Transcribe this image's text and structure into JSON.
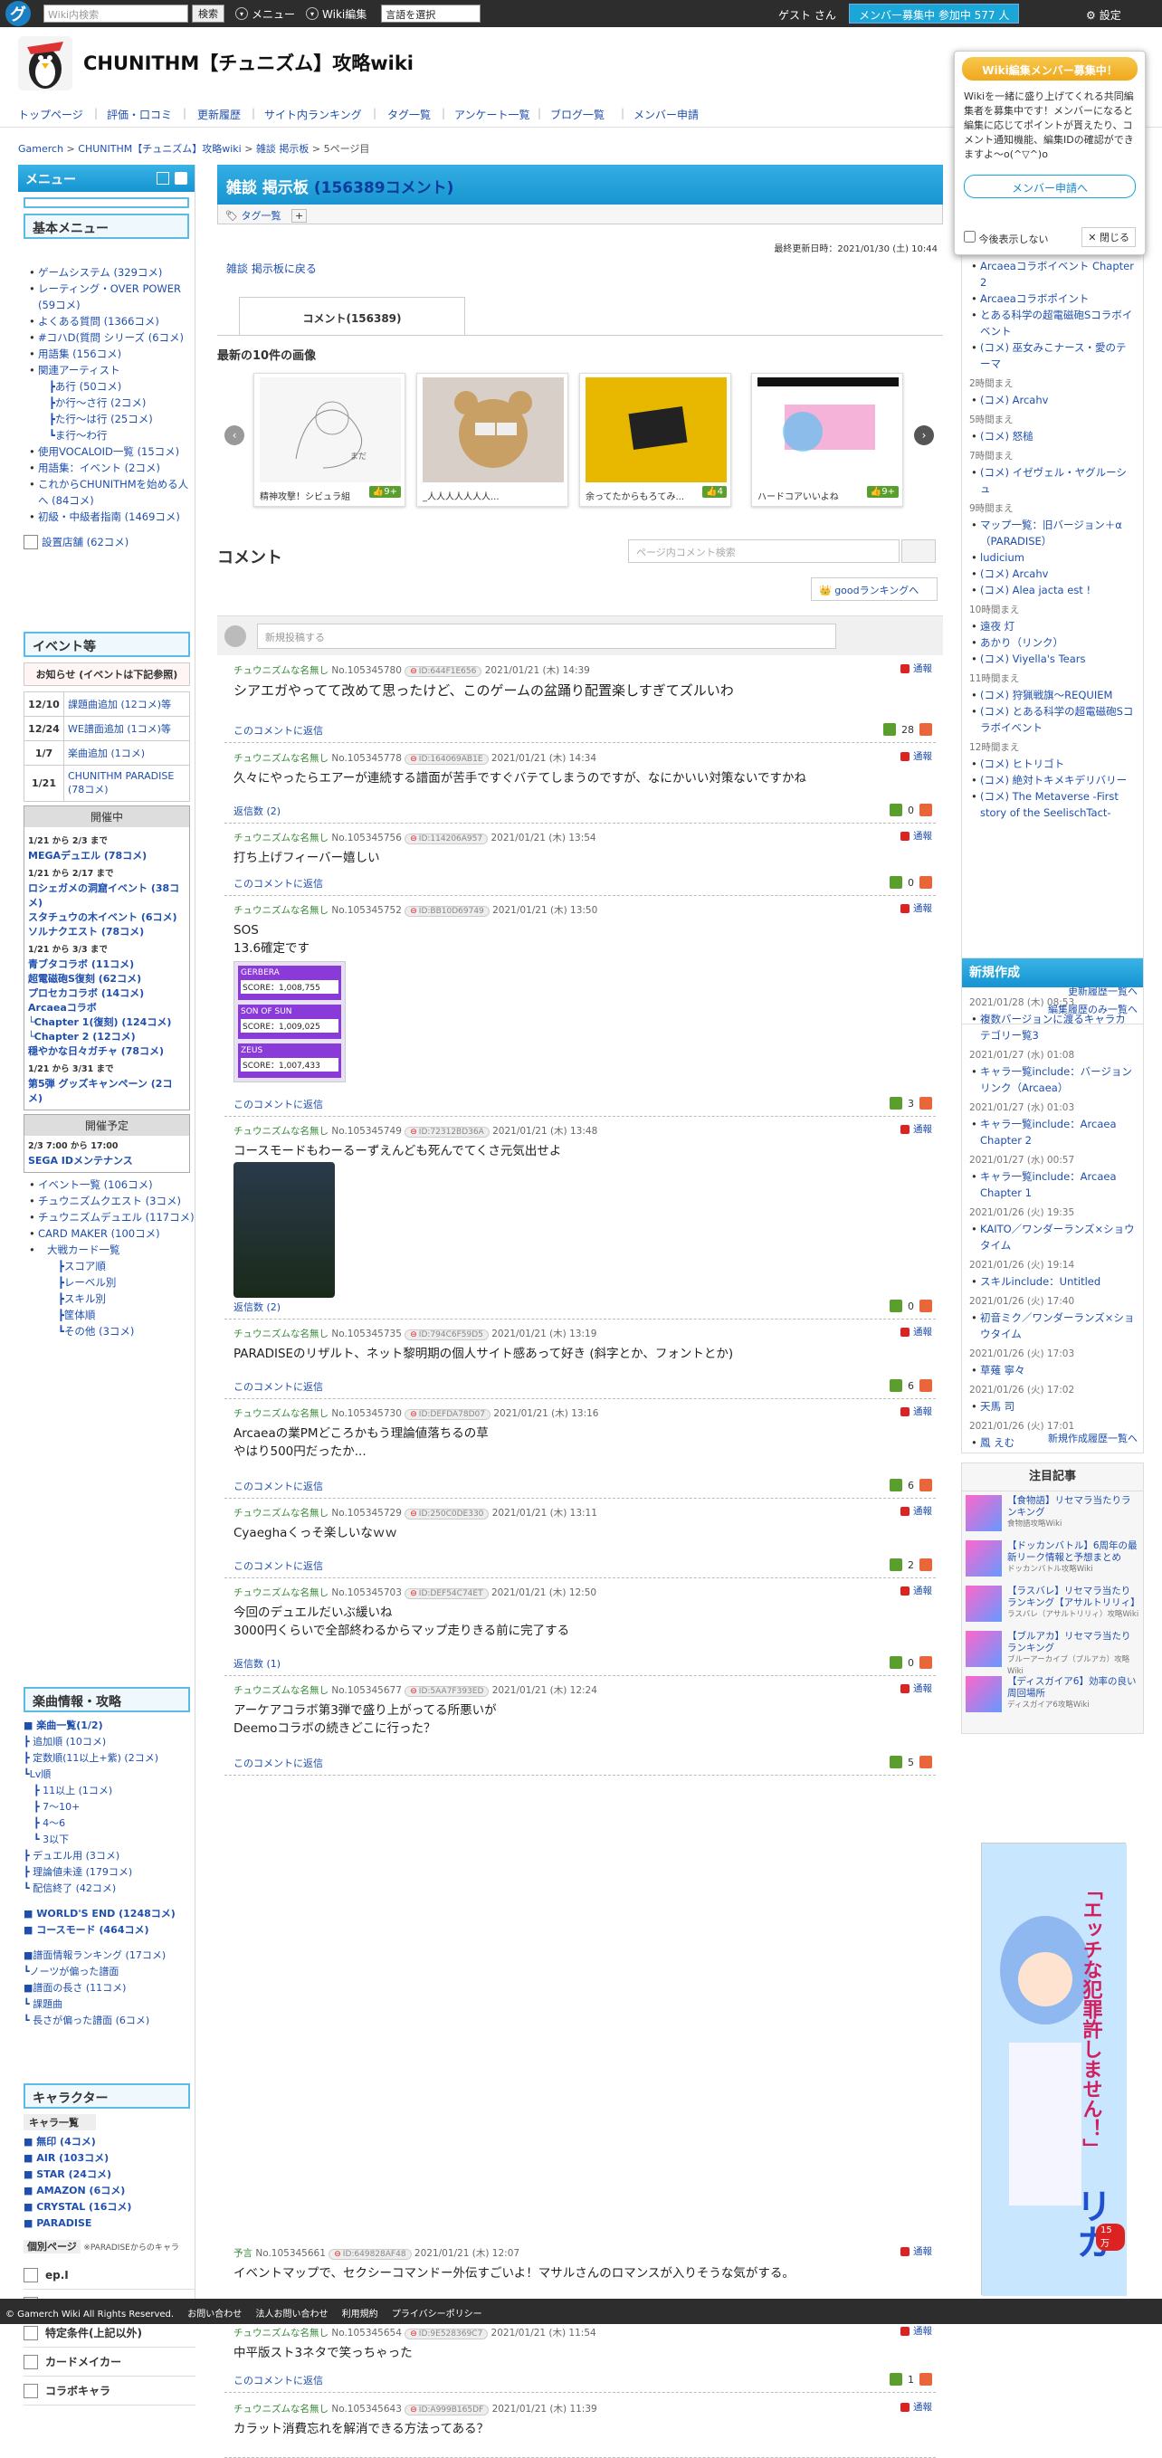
{
  "topbar": {
    "logo": "グ",
    "search_placeholder": "Wiki内検索",
    "search_btn": "検索",
    "menu": "メニュー",
    "wiki_edit": "Wiki編集",
    "lang": "言語を選択",
    "guest": "ゲスト さん",
    "member_btn": "メンバー募集中 参加中 577 人",
    "settings": "設定"
  },
  "header": {
    "title": "CHUNITHM【チュニズム】攻略wiki"
  },
  "nav": [
    "トップページ",
    "評価・口コミ",
    "更新履歴",
    "サイト内ランキング",
    "タグ一覧",
    "アンケート一覧",
    "ブログ一覧",
    "メンバー申請"
  ],
  "breadcrumb": [
    "Gamerch",
    "CHUNITHM【チュニズム】攻略wiki",
    "雑談 掲示板",
    "5ページ目"
  ],
  "left": {
    "menu_title": "メニュー",
    "basic": "基本メニュー",
    "basic_items": [
      "ゲームシステム (329コメ)",
      "レーティング・OVER POWER (59コメ)",
      "よくある質問 (1366コメ)",
      "#コハD(質問 シリーズ (6コメ)",
      "用語集 (156コメ)",
      "関連アーティスト",
      "┣あ行 (50コメ)",
      "┣か行～さ行 (2コメ)",
      "┣た行～は行 (25コメ)",
      "┗ま行～わ行",
      "使用VOCALOID一覧 (15コメ)",
      "用語集：イベント (2コメ)",
      "これからCHUNITHMを始める人へ (84コメ)",
      "初級・中級者指南 (1469コメ)"
    ],
    "store": "設置店舗 (62コメ)",
    "event_title": "イベント等",
    "notice_title": "お知らせ (イベントは下記参照)",
    "notices": [
      {
        "date": "12/10",
        "text": "課題曲追加 (12コメ)等"
      },
      {
        "date": "12/24",
        "text": "WE譜面追加 (1コメ)等"
      },
      {
        "date": "1/7",
        "text": "楽曲追加 (1コメ)"
      },
      {
        "date": "1/21",
        "text": "CHUNITHM PARADISE (78コメ)"
      }
    ],
    "ongoing": "開催中",
    "ongoing_items": [
      "1/21 から 2/3 まで",
      "MEGAデュエル (78コメ)",
      "1/21 から 2/17 まで",
      "ロシェガメの洞窟イベント (38コメ)",
      "スタチュウの木イベント (6コメ)",
      "ソルナクエスト (78コメ)",
      "1/21 から 3/3 まで",
      "青ブタコラボ (11コメ)",
      "超電磁砲S復刻 (62コメ)",
      "プロセカコラボ (14コメ)",
      "Arcaeaコラボ",
      "└Chapter 1(復刻) (124コメ)",
      "└Chapter 2 (12コメ)",
      "穏やかな日々ガチャ (78コメ)",
      "1/21 から 3/31 まで",
      "第5弾 グッズキャンペーン (2コメ)"
    ],
    "planned": "開催予定",
    "planned_items": [
      "2/3 7:00 から 17:00",
      "SEGA IDメンテナンス"
    ],
    "event_links": [
      "イベント一覧 (106コメ)",
      "チュウニズムクエスト (3コメ)",
      "チュウニズムデュエル (117コメ)",
      "CARD MAKER (100コメ)",
      "大戦カード一覧",
      "┣スコア順",
      "┣レーベル別",
      "┣スキル別",
      "┣筐体順",
      "┗その他 (3コメ)"
    ],
    "music_title": "楽曲情報・攻略",
    "music_items": [
      "■ 楽曲一覧(1/2)",
      "┣ 追加順 (10コメ)",
      "┣ 定数順(11以上+紫) (2コメ)",
      "┗Lv順",
      "　┣ 11以上 (1コメ)",
      "　┣ 7～10+",
      "　┣ 4～6",
      "　┗ 3以下",
      "┣ デュエル用 (3コメ)",
      "┣ 理論値未達 (179コメ)",
      "┗ 配信終了 (42コメ)",
      "",
      "■ WORLD'S END (1248コメ)",
      "■ コースモード (464コメ)",
      "",
      "■譜面情報ランキング (17コメ)",
      "┗ノーツが偏った譜面",
      "■譜面の長さ (11コメ)",
      "┗ 課題曲",
      "┗ 長さが偏った譜面 (6コメ)"
    ],
    "chara_title": "キャラクター",
    "chara_sub": "キャラ一覧",
    "chara_items": [
      "■ 無印 (4コメ)",
      "■ AIR (103コメ)",
      "■ STAR (24コメ)",
      "■ AMAZON (6コメ)",
      "■ CRYSTAL (16コメ)",
      "■ PARADISE"
    ],
    "indiv": "個別ページ",
    "indiv_note": "※PARADISEからのキャラ",
    "indiv_items": [
      "ep.I",
      "イロドリミドリ",
      "特定条件(上記以外)",
      "カードメイカー",
      "コラボキャラ"
    ]
  },
  "main": {
    "title": "雑談 掲示板",
    "count": "(156389コメント)",
    "tag": "タグ一覧",
    "updated": "最終更新日時：2021/01/30 (土) 10:44",
    "back": "雑談 掲示板に戻る",
    "tab": "コメント(156389)",
    "images_title": "最新の10件の画像",
    "images": [
      {
        "cap": "精神攻撃！シビュラ組",
        "likes": "9+"
      },
      {
        "cap": "_人人人人人人人...",
        "likes": ""
      },
      {
        "cap": "余ってたからもろてみ...",
        "likes": "4"
      },
      {
        "cap": "ハードコアいいよね",
        "likes": "9+"
      }
    ],
    "comments_title": "コメント",
    "search_placeholder": "ページ内コメント検索",
    "good_rank": "goodランキングへ",
    "new_post": "新規投稿する",
    "report": "通報",
    "comments": [
      {
        "name": "チュウニズムな名無し",
        "no": "No.105345780",
        "id": "ID:644F1E656",
        "date": "2021/01/21 (木) 14:39",
        "body": "シアエガやってて改めて思ったけど、このゲームの盆踊り配置楽しすぎてズルいわ",
        "reply": "このコメントに返信",
        "up": "28",
        "big": true
      },
      {
        "name": "チュウニズムな名無し",
        "no": "No.105345778",
        "id": "ID:164069AB1E",
        "date": "2021/01/21 (木) 14:34",
        "body": "久々にやったらエアーが連続する譜面が苦手ですぐバテてしまうのですが、なにかいい対策ないですかね",
        "reply": "返信数 (2)",
        "up": "0"
      },
      {
        "name": "チュウニズムな名無し",
        "no": "No.105345756",
        "id": "ID:114206A957",
        "date": "2021/01/21 (木) 13:54",
        "body": "打ち上げフィーバー嬉しい",
        "reply": "このコメントに返信",
        "up": "0"
      },
      {
        "name": "チュウニズムな名無し",
        "no": "No.105345752",
        "id": "ID:BB10D69749",
        "date": "2021/01/21 (木) 13:50",
        "body": "SOS\n13.6確定です",
        "reply": "このコメントに返信",
        "up": "3"
      },
      {
        "name": "チュウニズムな名無し",
        "no": "No.105345749",
        "id": "ID:72312BD36A",
        "date": "2021/01/21 (木) 13:48",
        "body": "コースモードもわーるーずえんども死んでてくさ元気出せよ",
        "reply": "返信数 (2)",
        "up": "0"
      },
      {
        "name": "チュウニズムな名無し",
        "no": "No.105345735",
        "id": "ID:794C6F59D5",
        "date": "2021/01/21 (木) 13:19",
        "body": "PARADISEのリザルト、ネット黎明期の個人サイト感あって好き (斜字とか、フォントとか)",
        "reply": "このコメントに返信",
        "up": "6"
      },
      {
        "name": "チュウニズムな名無し",
        "no": "No.105345730",
        "id": "ID:DEFDA78D07",
        "date": "2021/01/21 (木) 13:16",
        "body": "Arcaeaの業PMどころかもう理論値落ちるの草\nやはり500円だったか...",
        "reply": "このコメントに返信",
        "up": "6"
      },
      {
        "name": "チュウニズムな名無し",
        "no": "No.105345729",
        "id": "ID:250C0DE330",
        "date": "2021/01/21 (木) 13:11",
        "body": "Cyaeghaくっそ楽しいなｗｗ",
        "reply": "このコメントに返信",
        "up": "2"
      },
      {
        "name": "チュウニズムな名無し",
        "no": "No.105345703",
        "id": "ID:DEF54C74ET",
        "date": "2021/01/21 (木) 12:50",
        "body": "今回のデュエルだいぶ緩いね\n3000円くらいで全部終わるからマップ走りきる前に完了する",
        "reply": "返信数 (1)",
        "up": "0"
      },
      {
        "name": "チュウニズムな名無し",
        "no": "No.105345677",
        "id": "ID:5AA7F393ED",
        "date": "2021/01/21 (木) 12:24",
        "body": "アーケアコラボ第3弾で盛り上がってる所悪いが\nDeemoコラボの続きどこに行った？",
        "reply": "このコメントに返信",
        "up": "5"
      },
      {
        "name": "予言",
        "no": "No.105345661",
        "id": "ID:649828AF48",
        "date": "2021/01/21 (木) 12:07",
        "body": "イベントマップで、セクシーコマンドー外伝すごいよ！マサルさんのロマンスが入りそうな気がする。",
        "reply": "このコメントに返信",
        "up": "0"
      },
      {
        "name": "チュウニズムな名無し",
        "no": "No.105345654",
        "id": "ID:9E528369C7",
        "date": "2021/01/21 (木) 11:54",
        "body": "中平版スト3ネタで笑っちゃった",
        "reply": "このコメントに返信",
        "up": "1"
      },
      {
        "name": "チュウニズムな名無し",
        "no": "No.105345643",
        "id": "ID:A999B165DF",
        "date": "2021/01/21 (木) 11:39",
        "body": "カラット消費忘れを解消できる方法ってある？",
        "reply": "",
        "up": ""
      }
    ],
    "scores": [
      {
        "song": "GERBERA",
        "score": "SCORE：1,008,755"
      },
      {
        "song": "SON OF SUN",
        "score": "SCORE：1,009,025"
      },
      {
        "song": "ZEUS",
        "score": "SCORE：1,007,433"
      }
    ]
  },
  "popup": {
    "title": "Wiki編集メンバー募集中！",
    "body": "Wikiを一緒に盛り上げてくれる共同編集者を募集中です！メンバーになると編集に応じてポイントが貰えたり、コメント通知機能、編集IDの確認ができますよ～o(^▽^)o",
    "btn": "メンバー申請へ",
    "noshow": "今後表示しない",
    "close": "閉じる"
  },
  "right": {
    "recent": [
      "Arcaeaコラボイベント Chapter 2",
      "Arcaeaコラボポイント",
      "とある科学の超電磁砲Sコラボイベント",
      "(コメ) 巫女みこナース・愛のテーマ",
      "2時間まえ",
      "(コメ) Arcahv",
      "5時間まえ",
      "(コメ) 怒槌",
      "7時間まえ",
      "(コメ) イゼヴェル・ヤグルーシュ",
      "9時間まえ",
      "マップ一覧：旧バージョン＋α（PARADISE）",
      "ludicium",
      "(コメ) Arcahv",
      "(コメ) Alea jacta est !",
      "10時間まえ",
      "遠夜 灯",
      "あかり（リンク）",
      "(コメ) Viyella's Tears",
      "11時間まえ",
      "(コメ) 狩猟戦旗～REQUIEM",
      "(コメ) とある科学の超電磁砲Sコラボイベント",
      "12時間まえ",
      "(コメ) ヒトリゴト",
      "(コメ) 絶対トキメキデリバリー",
      "(コメ) The Metaverse -First story of the SeelischTact-"
    ],
    "more1": "更新履歴一覧へ",
    "more2": "編集履歴のみ一覧へ",
    "new_title": "新規作成",
    "new_items": [
      {
        "t": "2021/01/28 (木) 08:53",
        "i": "複数バージョンに渡るキャラカテゴリー覧3"
      },
      {
        "t": "2021/01/27 (水) 01:08",
        "i": "キャラ一覧include：バージョンリンク（Arcaea）"
      },
      {
        "t": "2021/01/27 (水) 01:03",
        "i": "キャラ一覧include：Arcaea Chapter 2"
      },
      {
        "t": "2021/01/27 (水) 00:57",
        "i": "キャラ一覧include：Arcaea Chapter 1"
      },
      {
        "t": "2021/01/26 (火) 19:35",
        "i": "KAITO／ワンダーランズ×ショウタイム"
      },
      {
        "t": "2021/01/26 (火) 19:14",
        "i": "スキルinclude：Untitled"
      },
      {
        "t": "2021/01/26 (火) 17:40",
        "i": "初音ミク／ワンダーランズ×ショウタイム"
      },
      {
        "t": "2021/01/26 (火) 17:03",
        "i": "草薙 寧々"
      },
      {
        "t": "2021/01/26 (火) 17:02",
        "i": "天馬 司"
      },
      {
        "t": "2021/01/26 (火) 17:01",
        "i": "鳳 えむ"
      }
    ],
    "new_more": "新規作成履歴一覧へ",
    "pick_title": "注目記事",
    "picks": [
      {
        "t": "【食物語】リセマラ当たりランキング",
        "s": "食物語攻略Wiki"
      },
      {
        "t": "【ドッカンバトル】6周年の最新リーク情報と予想まとめ",
        "s": "ドッカンバトル攻略Wiki"
      },
      {
        "t": "【ラスバレ】リセマラ当たりランキング【アサルトリリィ】",
        "s": "ラスバレ（アサルトリリィ）攻略Wiki"
      },
      {
        "t": "【ブルアカ】リセマラ当たりランキング",
        "s": "ブルーアーカイブ（ブルアカ）攻略Wiki"
      },
      {
        "t": "【ディスガイア6】効率の良い周回場所",
        "s": "ディスガイア6攻略Wiki"
      }
    ],
    "ad_count": "15万"
  },
  "footer": [
    "© Gamerch Wiki All Rights Reserved.",
    "お問い合わせ",
    "法人お問い合わせ",
    "利用規約",
    "プライバシーポリシー"
  ]
}
